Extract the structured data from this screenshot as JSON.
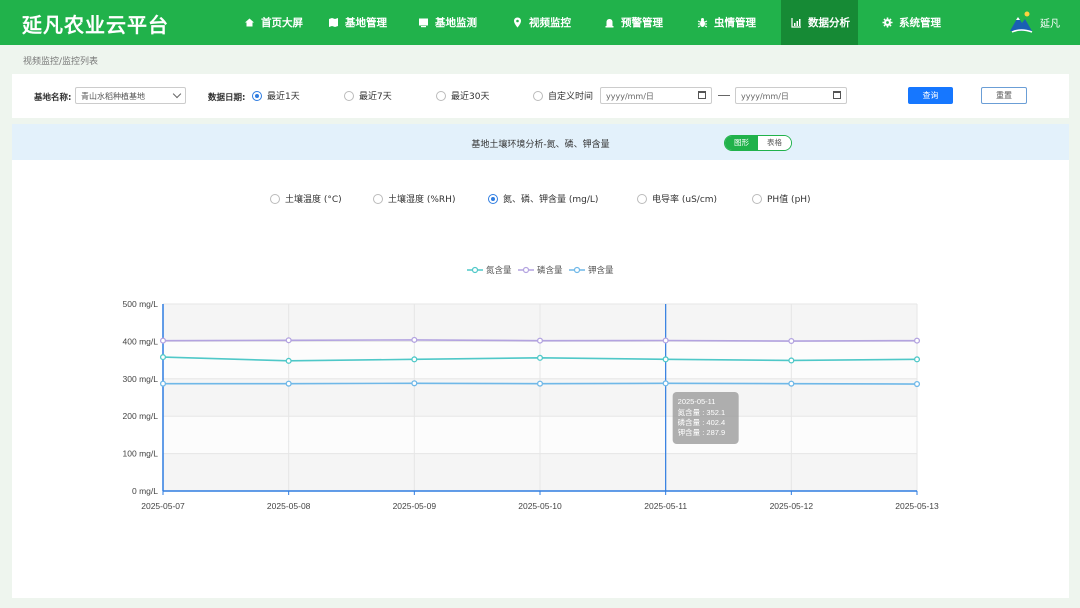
{
  "app": {
    "title": "延凡农业云平台"
  },
  "nav": {
    "items": [
      {
        "label": "首页大屏",
        "icon": "home-icon",
        "active": false
      },
      {
        "label": "基地管理",
        "icon": "map-icon",
        "active": false
      },
      {
        "label": "基地监测",
        "icon": "monitor-icon",
        "active": false
      },
      {
        "label": "视频监控",
        "icon": "location-pin-icon",
        "active": false
      },
      {
        "label": "预警管理",
        "icon": "alarm-icon",
        "active": false
      },
      {
        "label": "虫情管理",
        "icon": "bug-icon",
        "active": false
      },
      {
        "label": "数据分析",
        "icon": "chart-icon",
        "active": true
      },
      {
        "label": "系统管理",
        "icon": "gear-icon",
        "active": false
      }
    ]
  },
  "user": {
    "name": "延凡",
    "logo": "mountain-logo-icon"
  },
  "breadcrumb": "视频监控/监控列表",
  "filter": {
    "base_label": "基地名称:",
    "base_value": "青山水稻种植基地",
    "date_label": "数据日期:",
    "ranges": [
      {
        "label": "最近1天",
        "checked": true
      },
      {
        "label": "最近7天",
        "checked": false
      },
      {
        "label": "最近30天",
        "checked": false
      },
      {
        "label": "自定义时间",
        "checked": false
      }
    ],
    "start_placeholder": "yyyy/mm/日",
    "end_placeholder": "yyyy/mm/日",
    "query_label": "查询",
    "reset_label": "重置"
  },
  "panel": {
    "title": "基地土壤环境分析-氮、磷、钾含量",
    "view_chart": "图形",
    "view_table": "表格",
    "metrics": [
      {
        "label": "土壤温度 (°C)",
        "checked": false
      },
      {
        "label": "土壤湿度 (%RH)",
        "checked": false
      },
      {
        "label": "氮、磷、钾含量 (mg/L)",
        "checked": true
      },
      {
        "label": "电导率 (uS/cm)",
        "checked": false
      },
      {
        "label": "PH值 (pH)",
        "checked": false
      }
    ]
  },
  "colors": {
    "brand": "#21b24b",
    "nav_active": "#168a35",
    "primary_button": "#1677ff"
  },
  "chart_data": {
    "type": "line",
    "x": [
      "2025-05-07",
      "2025-05-08",
      "2025-05-09",
      "2025-05-10",
      "2025-05-11",
      "2025-05-12",
      "2025-05-13"
    ],
    "ylim": [
      0,
      500
    ],
    "yticks": [
      "0 mg/L",
      "100 mg/L",
      "200 mg/L",
      "300 mg/L",
      "400 mg/L",
      "500 mg/L"
    ],
    "legend_position": "top",
    "series": [
      {
        "name": "氮含量",
        "color": "#4fc8c8",
        "values": [
          358,
          348,
          352,
          356,
          352.1,
          349,
          352
        ]
      },
      {
        "name": "磷含量",
        "color": "#b3a3e0",
        "values": [
          402,
          403,
          404,
          402,
          402.4,
          401,
          402
        ]
      },
      {
        "name": "钾含量",
        "color": "#6fb8e8",
        "values": [
          287,
          287,
          288,
          287,
          287.9,
          287,
          286
        ]
      }
    ],
    "tooltip": {
      "date": "2025-05-11",
      "rows": [
        "氮含量 : 352.1",
        "磷含量 : 402.4",
        "钾含量 : 287.9"
      ]
    }
  }
}
